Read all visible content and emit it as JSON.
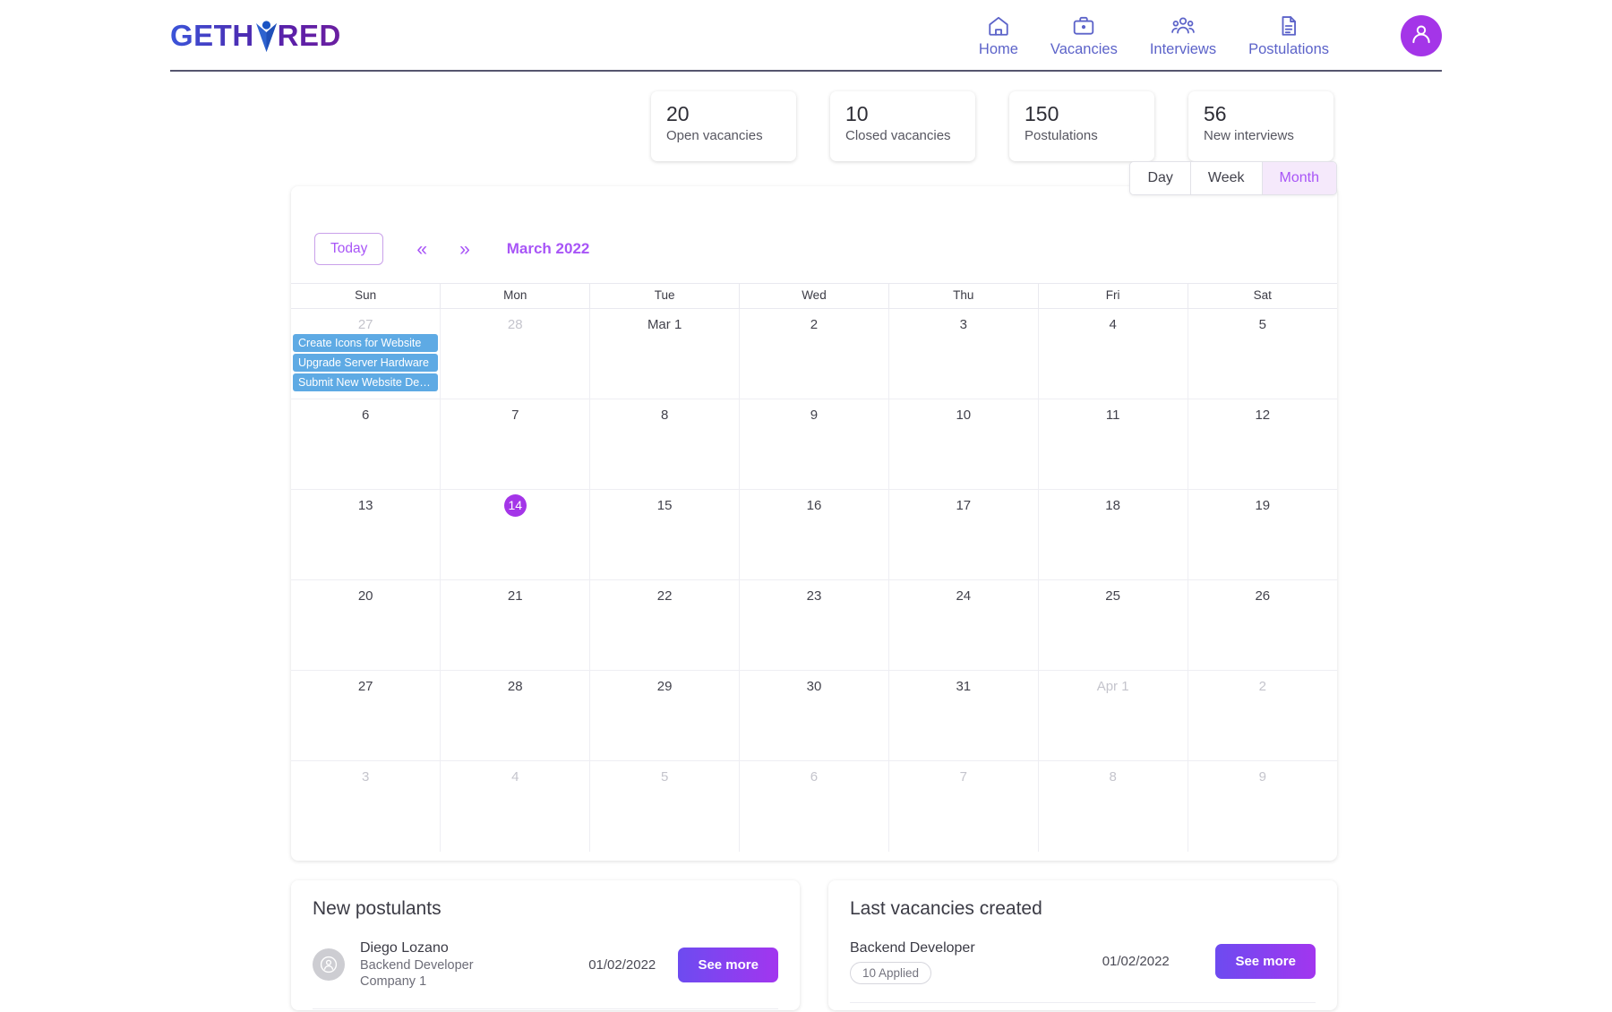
{
  "header": {
    "logo": {
      "text_part1": "GETH",
      "text_part2": "RED",
      "mark": "person-figure-icon"
    },
    "nav": [
      {
        "label": "Home",
        "icon": "home-icon"
      },
      {
        "label": "Vacancies",
        "icon": "briefcase-icon"
      },
      {
        "label": "Interviews",
        "icon": "people-group-icon"
      },
      {
        "label": "Postulations",
        "icon": "document-icon"
      }
    ],
    "avatar": {
      "icon": "user-avatar-icon",
      "color": "#a435e8"
    }
  },
  "stats": [
    {
      "value": "20",
      "label": "Open vacancies"
    },
    {
      "value": "10",
      "label": "Closed vacancies"
    },
    {
      "value": "150",
      "label": "Postulations"
    },
    {
      "value": "56",
      "label": "New interviews"
    }
  ],
  "calendar": {
    "view_toggle": [
      {
        "label": "Day",
        "active": false
      },
      {
        "label": "Week",
        "active": false
      },
      {
        "label": "Month",
        "active": true
      }
    ],
    "today_label": "Today",
    "prev_icon": "«",
    "next_icon": "»",
    "title": "March 2022",
    "weekdays": [
      "Sun",
      "Mon",
      "Tue",
      "Wed",
      "Thu",
      "Fri",
      "Sat"
    ],
    "weeks": [
      [
        {
          "num": "27",
          "muted": true,
          "today": false,
          "events": [
            "Create Icons for Website",
            "Upgrade Server Hardware",
            "Submit New Website Desi…"
          ]
        },
        {
          "num": "28",
          "muted": true,
          "today": false,
          "events": []
        },
        {
          "num": "Mar 1",
          "muted": false,
          "today": false,
          "events": []
        },
        {
          "num": "2",
          "muted": false,
          "today": false,
          "events": []
        },
        {
          "num": "3",
          "muted": false,
          "today": false,
          "events": []
        },
        {
          "num": "4",
          "muted": false,
          "today": false,
          "events": []
        },
        {
          "num": "5",
          "muted": false,
          "today": false,
          "events": []
        }
      ],
      [
        {
          "num": "6",
          "muted": false,
          "today": false,
          "events": []
        },
        {
          "num": "7",
          "muted": false,
          "today": false,
          "events": []
        },
        {
          "num": "8",
          "muted": false,
          "today": false,
          "events": []
        },
        {
          "num": "9",
          "muted": false,
          "today": false,
          "events": []
        },
        {
          "num": "10",
          "muted": false,
          "today": false,
          "events": []
        },
        {
          "num": "11",
          "muted": false,
          "today": false,
          "events": []
        },
        {
          "num": "12",
          "muted": false,
          "today": false,
          "events": []
        }
      ],
      [
        {
          "num": "13",
          "muted": false,
          "today": false,
          "events": []
        },
        {
          "num": "14",
          "muted": false,
          "today": true,
          "events": []
        },
        {
          "num": "15",
          "muted": false,
          "today": false,
          "events": []
        },
        {
          "num": "16",
          "muted": false,
          "today": false,
          "events": []
        },
        {
          "num": "17",
          "muted": false,
          "today": false,
          "events": []
        },
        {
          "num": "18",
          "muted": false,
          "today": false,
          "events": []
        },
        {
          "num": "19",
          "muted": false,
          "today": false,
          "events": []
        }
      ],
      [
        {
          "num": "20",
          "muted": false,
          "today": false,
          "events": []
        },
        {
          "num": "21",
          "muted": false,
          "today": false,
          "events": []
        },
        {
          "num": "22",
          "muted": false,
          "today": false,
          "events": []
        },
        {
          "num": "23",
          "muted": false,
          "today": false,
          "events": []
        },
        {
          "num": "24",
          "muted": false,
          "today": false,
          "events": []
        },
        {
          "num": "25",
          "muted": false,
          "today": false,
          "events": []
        },
        {
          "num": "26",
          "muted": false,
          "today": false,
          "events": []
        }
      ],
      [
        {
          "num": "27",
          "muted": false,
          "today": false,
          "events": []
        },
        {
          "num": "28",
          "muted": false,
          "today": false,
          "events": []
        },
        {
          "num": "29",
          "muted": false,
          "today": false,
          "events": []
        },
        {
          "num": "30",
          "muted": false,
          "today": false,
          "events": []
        },
        {
          "num": "31",
          "muted": false,
          "today": false,
          "events": []
        },
        {
          "num": "Apr 1",
          "muted": true,
          "today": false,
          "events": []
        },
        {
          "num": "2",
          "muted": true,
          "today": false,
          "events": []
        }
      ],
      [
        {
          "num": "3",
          "muted": true,
          "today": false,
          "events": []
        },
        {
          "num": "4",
          "muted": true,
          "today": false,
          "events": []
        },
        {
          "num": "5",
          "muted": true,
          "today": false,
          "events": []
        },
        {
          "num": "6",
          "muted": true,
          "today": false,
          "events": []
        },
        {
          "num": "7",
          "muted": true,
          "today": false,
          "events": []
        },
        {
          "num": "8",
          "muted": true,
          "today": false,
          "events": []
        },
        {
          "num": "9",
          "muted": true,
          "today": false,
          "events": []
        }
      ]
    ]
  },
  "postulants_panel": {
    "title": "New postulants",
    "rows": [
      {
        "avatar_icon": "user-avatar-icon",
        "name": "Diego Lozano",
        "role": "Backend Developer",
        "company": "Company 1",
        "date": "01/02/2022",
        "button": "See more"
      }
    ]
  },
  "vacancies_panel": {
    "title": "Last vacancies created",
    "rows": [
      {
        "name": "Backend Developer",
        "badge": "10 Applied",
        "date": "01/02/2022",
        "button": "See more"
      }
    ]
  },
  "colors": {
    "accent_purple": "#a855f7",
    "avatar_purple": "#a435e8",
    "nav_blue": "#5c63c9",
    "event_blue": "#5eaae4",
    "button_gradient_start": "#6d4bf0",
    "button_gradient_end": "#a236ef"
  }
}
